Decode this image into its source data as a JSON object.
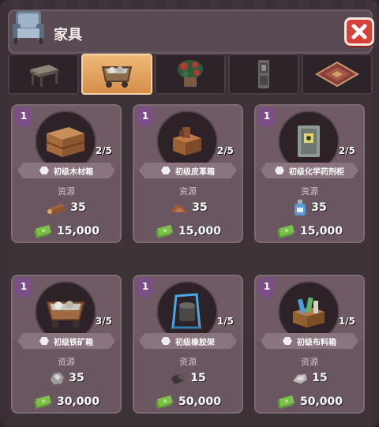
{
  "header": {
    "title": "家具"
  },
  "tabs": [
    {
      "icon": "table-icon",
      "active": false
    },
    {
      "icon": "ore-cart-icon",
      "active": true
    },
    {
      "icon": "plant-icon",
      "active": false
    },
    {
      "icon": "locker-icon",
      "active": false
    },
    {
      "icon": "rug-icon",
      "active": false
    }
  ],
  "resource_label": "资源",
  "cards": [
    {
      "level": "1",
      "progress": "2/5",
      "name": "初级木材箱",
      "resource_icon": "logs-icon",
      "resource_amount": "35",
      "cost": "15,000"
    },
    {
      "level": "1",
      "progress": "2/5",
      "name": "初级皮革箱",
      "resource_icon": "leather-icon",
      "resource_amount": "35",
      "cost": "15,000"
    },
    {
      "level": "1",
      "progress": "2/5",
      "name": "初级化学药剂柜",
      "resource_icon": "chemical-bottle-icon",
      "resource_amount": "35",
      "cost": "15,000"
    },
    {
      "level": "1",
      "progress": "3/5",
      "name": "初级铁矿箱",
      "resource_icon": "iron-ore-icon",
      "resource_amount": "35",
      "cost": "30,000"
    },
    {
      "level": "1",
      "progress": "1/5",
      "name": "初级橡胶架",
      "resource_icon": "rubber-icon",
      "resource_amount": "15",
      "cost": "50,000"
    },
    {
      "level": "1",
      "progress": "1/5",
      "name": "初级布料箱",
      "resource_icon": "cloth-icon",
      "resource_amount": "15",
      "cost": "50,000"
    }
  ],
  "colors": {
    "accent_tab": "#d58e4a",
    "close_button": "#d8413a",
    "level_flag": "#7c4f86",
    "money_green": "#7cc04a"
  }
}
